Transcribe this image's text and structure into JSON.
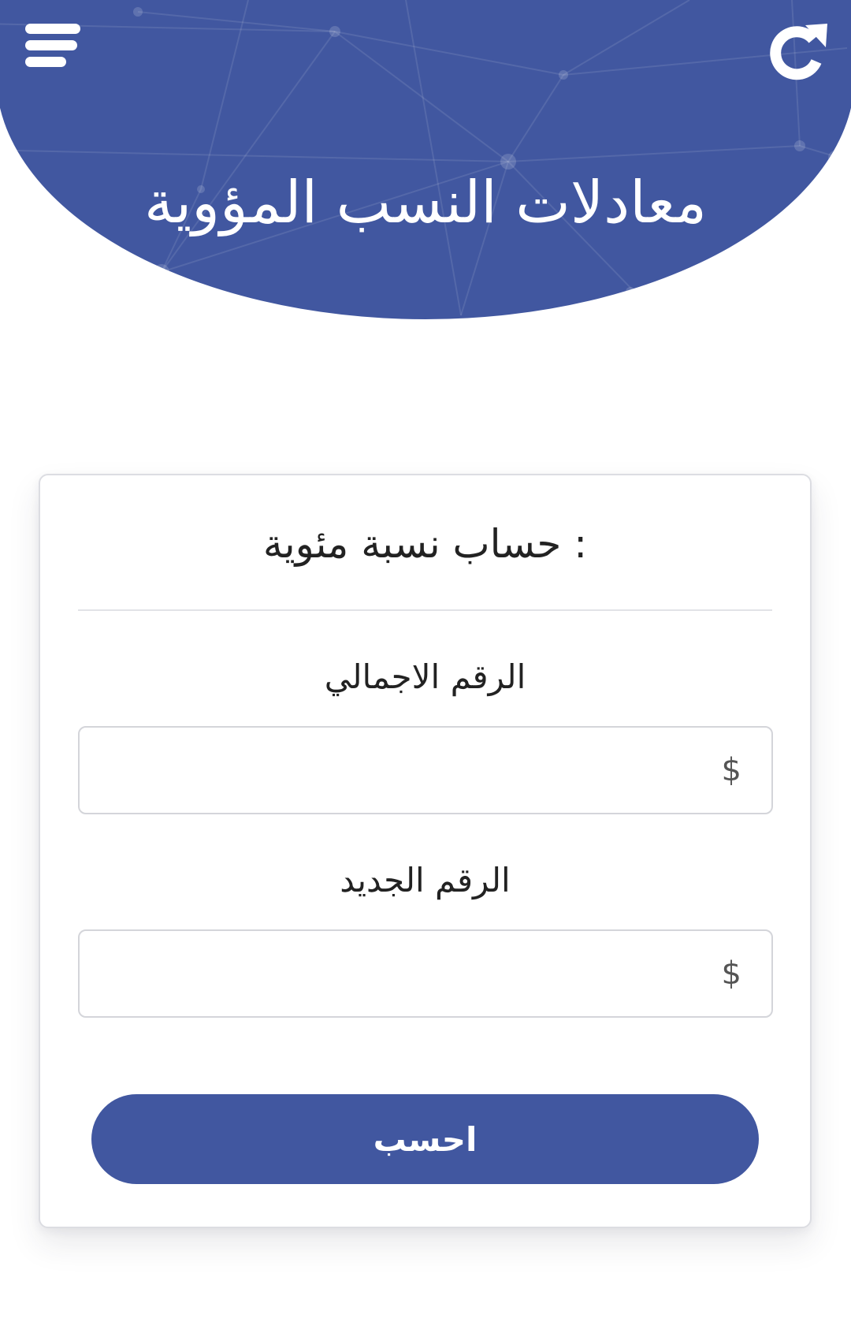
{
  "header": {
    "title": "معادلات النسب المؤوية",
    "menu_icon": "hamburger-menu-icon",
    "refresh_icon": "refresh-icon",
    "background_color": "#4157a0"
  },
  "card": {
    "title": "حساب نسبة مئوية :",
    "fields": [
      {
        "label": "الرقم الاجمالي",
        "placeholder": "$",
        "value": ""
      },
      {
        "label": "الرقم الجديد",
        "placeholder": "$",
        "value": ""
      }
    ],
    "submit_label": "احسب"
  }
}
